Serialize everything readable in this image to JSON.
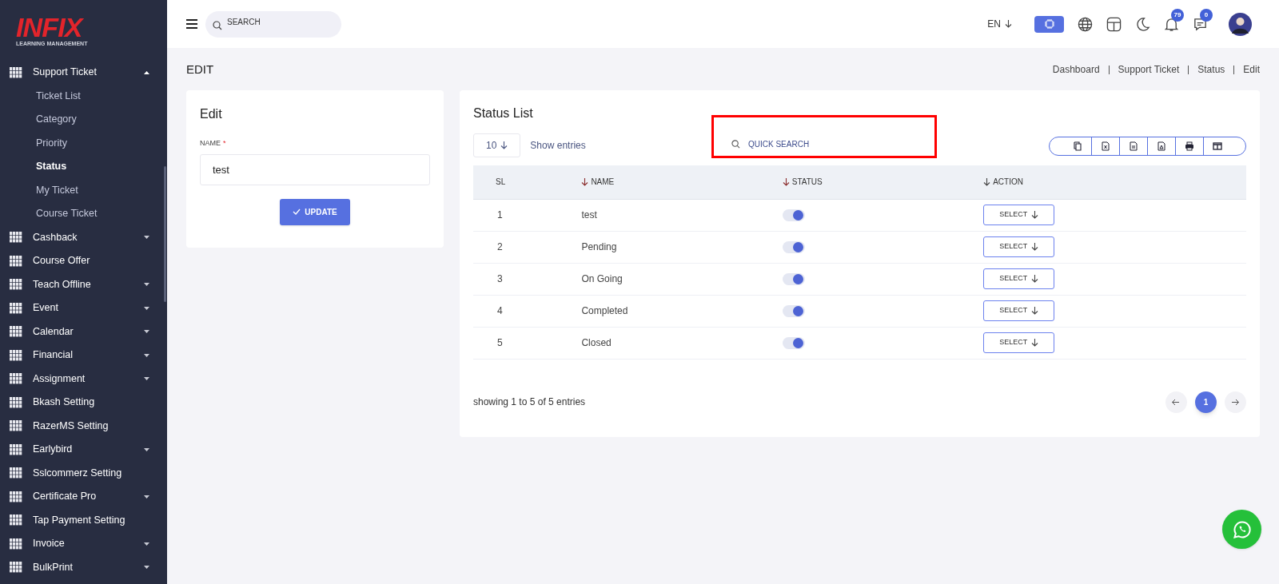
{
  "logo": {
    "title": "INFIX",
    "subtitle": "LEARNING MANAGEMENT"
  },
  "sidebar": {
    "items": [
      {
        "label": "Support Ticket",
        "expanded": true,
        "children": [
          {
            "label": "Ticket List",
            "selected": false
          },
          {
            "label": "Category",
            "selected": false
          },
          {
            "label": "Priority",
            "selected": false
          },
          {
            "label": "Status",
            "selected": true
          },
          {
            "label": "My Ticket",
            "selected": false
          },
          {
            "label": "Course Ticket",
            "selected": false
          }
        ]
      },
      {
        "label": "Cashback",
        "expanded": false
      },
      {
        "label": "Course Offer"
      },
      {
        "label": "Teach Offline",
        "expanded": false
      },
      {
        "label": "Event",
        "expanded": false
      },
      {
        "label": "Calendar",
        "expanded": false
      },
      {
        "label": "Financial",
        "expanded": false
      },
      {
        "label": "Assignment",
        "expanded": false
      },
      {
        "label": "Bkash Setting"
      },
      {
        "label": "RazerMS Setting"
      },
      {
        "label": "Earlybird",
        "expanded": false
      },
      {
        "label": "Sslcommerz Setting"
      },
      {
        "label": "Certificate Pro",
        "expanded": false
      },
      {
        "label": "Tap Payment Setting"
      },
      {
        "label": "Invoice",
        "expanded": false
      },
      {
        "label": "BulkPrint",
        "expanded": false
      }
    ]
  },
  "topbar": {
    "search": {
      "placeholder": "SEARCH"
    },
    "language": "EN",
    "notifications": "79",
    "messages": "0"
  },
  "page_title": "EDIT",
  "breadcrumb": [
    "Dashboard",
    "Support Ticket",
    "Status",
    "Edit"
  ],
  "edit_card": {
    "title": "Edit",
    "field_label": "NAME",
    "required_mark": "*",
    "value": "test",
    "button": "UPDATE"
  },
  "status_list": {
    "title": "Status List",
    "page_size": "10",
    "show_entries": "Show entries",
    "quick_search": {
      "placeholder": "QUICK SEARCH"
    },
    "columns": [
      {
        "label": "SL",
        "sortable": false
      },
      {
        "label": "NAME",
        "sortable": true
      },
      {
        "label": "STATUS",
        "sortable": true
      },
      {
        "label": "ACTION",
        "sortable": true
      }
    ],
    "rows": [
      {
        "sl": "1",
        "name": "test",
        "on": true,
        "action": "SELECT"
      },
      {
        "sl": "2",
        "name": "Pending",
        "on": true,
        "action": "SELECT"
      },
      {
        "sl": "3",
        "name": "On Going",
        "on": true,
        "action": "SELECT"
      },
      {
        "sl": "4",
        "name": "Completed",
        "on": true,
        "action": "SELECT"
      },
      {
        "sl": "5",
        "name": "Closed",
        "on": true,
        "action": "SELECT"
      }
    ],
    "summary": "showing 1 to 5 of 5 entries",
    "pages": [
      {
        "label": "1",
        "selected": true
      }
    ]
  }
}
